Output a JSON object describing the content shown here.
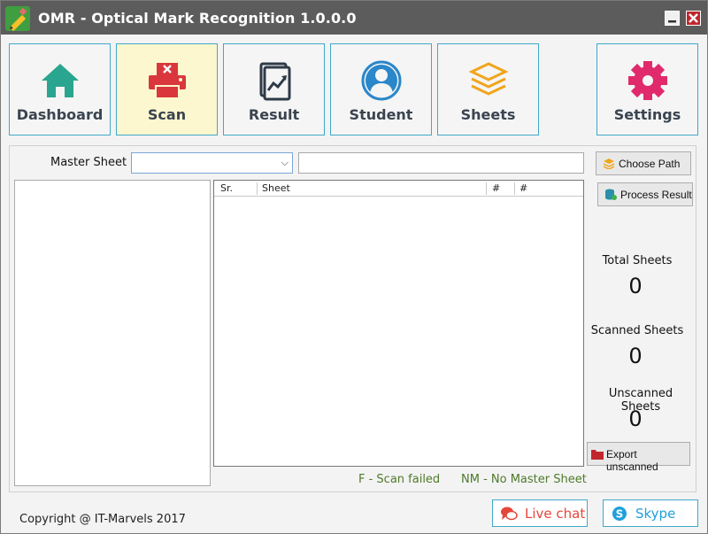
{
  "window": {
    "title": "OMR - Optical Mark Recognition 1.0.0.0"
  },
  "nav": {
    "dashboard": "Dashboard",
    "scan": "Scan",
    "result": "Result",
    "student": "Student",
    "sheets": "Sheets",
    "settings": "Settings"
  },
  "scan_panel": {
    "master_sheet_label": "Master Sheet :",
    "master_sheet_value": "",
    "path_value": "",
    "grid_columns": [
      "Sr.",
      "Sheet",
      "#",
      "#"
    ],
    "choose_path": "Choose Path",
    "process_result": "Process Result",
    "export_unscanned": "Export unscanned"
  },
  "stats": {
    "total_label": "Total Sheets",
    "total_value": "0",
    "scanned_label": "Scanned Sheets",
    "scanned_value": "0",
    "unscanned_label": "Unscanned Sheets",
    "unscanned_value": "0"
  },
  "legend": {
    "scan_failed": "F - Scan failed",
    "no_master": "NM - No Master Sheet"
  },
  "footer": {
    "copyright": "Copyright @ IT-Marvels 2017",
    "live_chat": "Live chat",
    "skype": "Skype"
  },
  "colors": {
    "titlebar": "#5c5c5c",
    "accent_border": "#3fa9c9",
    "active_tab": "#fdf7cf",
    "dashboard_icon": "#2aa58f",
    "scan_icon": "#d9373d",
    "result_icon": "#2f3a48",
    "student_icon": "#2a87c9",
    "sheets_icon": "#f0a51c",
    "settings_icon": "#e02a6c",
    "live_chat": "#e4473a",
    "skype": "#1fa0dc"
  },
  "icons": {
    "app": "pencil-icon",
    "dashboard": "home-icon",
    "scan": "printer-error-icon",
    "result": "chart-document-icon",
    "student": "user-avatar-icon",
    "sheets": "stack-layers-icon",
    "settings": "gear-icon"
  }
}
